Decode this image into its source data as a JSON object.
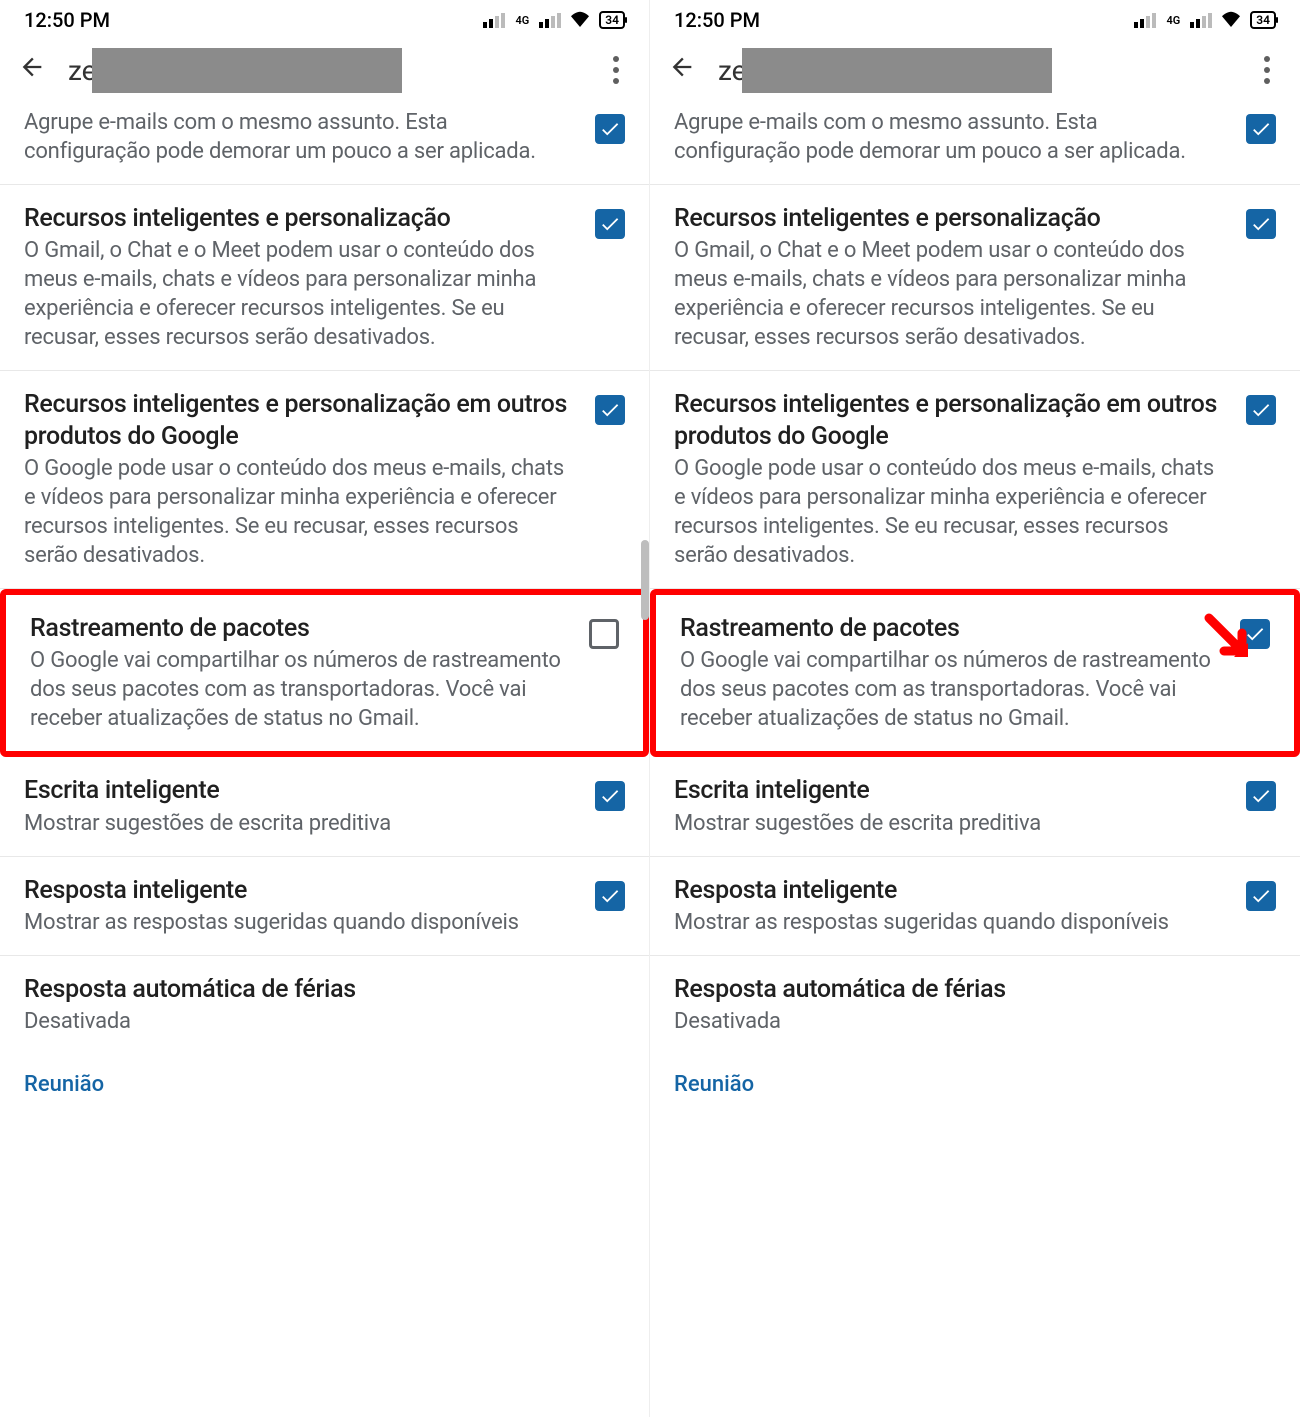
{
  "status": {
    "time": "12:50 PM",
    "battery": "34",
    "net_label": "4G"
  },
  "header": {
    "title_prefix": "ze"
  },
  "settings": {
    "group_emails": {
      "subtitle": "Agrupe e-mails com o mesmo assunto. Esta configuração pode demorar um pouco a ser aplicada."
    },
    "smart_features": {
      "title": "Recursos inteligentes e personalização",
      "subtitle": "O Gmail, o Chat e o Meet podem usar o conteúdo dos meus e-mails, chats e vídeos para personalizar minha experiência e oferecer recursos inteligentes. Se eu recusar, esses recursos serão desativados."
    },
    "smart_features_other": {
      "title": "Recursos inteligentes e personalização em outros produtos do Google",
      "subtitle": "O Google pode usar o conteúdo dos meus e-mails, chats e vídeos para personalizar minha experiência e oferecer recursos inteligentes. Se eu recusar, esses recursos serão desativados."
    },
    "package_tracking": {
      "title": "Rastreamento de pacotes",
      "subtitle": "O Google vai compartilhar os números de rastreamento dos seus pacotes com as transportadoras. Você vai receber atualizações de status no Gmail."
    },
    "smart_compose": {
      "title": "Escrita inteligente",
      "subtitle": "Mostrar sugestões de escrita preditiva"
    },
    "smart_reply": {
      "title": "Resposta inteligente",
      "subtitle": "Mostrar as respostas sugeridas quando disponíveis"
    },
    "vacation": {
      "title": "Resposta automática de férias",
      "subtitle": "Desativada"
    },
    "meeting": {
      "title": "Reunião"
    }
  },
  "checkbox_states": {
    "left": {
      "group_emails": true,
      "smart_features": true,
      "smart_features_other": true,
      "package_tracking": false,
      "smart_compose": true,
      "smart_reply": true
    },
    "right": {
      "group_emails": true,
      "smart_features": true,
      "smart_features_other": true,
      "package_tracking": true,
      "smart_compose": true,
      "smart_reply": true
    }
  }
}
